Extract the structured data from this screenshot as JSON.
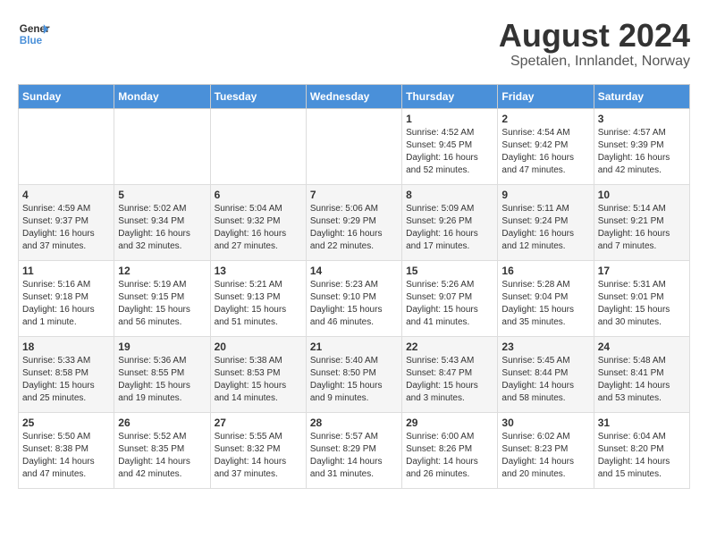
{
  "header": {
    "logo_general": "General",
    "logo_blue": "Blue",
    "title": "August 2024",
    "subtitle": "Spetalen, Innlandet, Norway"
  },
  "weekdays": [
    "Sunday",
    "Monday",
    "Tuesday",
    "Wednesday",
    "Thursday",
    "Friday",
    "Saturday"
  ],
  "weeks": [
    [
      {
        "day": "",
        "info": ""
      },
      {
        "day": "",
        "info": ""
      },
      {
        "day": "",
        "info": ""
      },
      {
        "day": "",
        "info": ""
      },
      {
        "day": "1",
        "info": "Sunrise: 4:52 AM\nSunset: 9:45 PM\nDaylight: 16 hours\nand 52 minutes."
      },
      {
        "day": "2",
        "info": "Sunrise: 4:54 AM\nSunset: 9:42 PM\nDaylight: 16 hours\nand 47 minutes."
      },
      {
        "day": "3",
        "info": "Sunrise: 4:57 AM\nSunset: 9:39 PM\nDaylight: 16 hours\nand 42 minutes."
      }
    ],
    [
      {
        "day": "4",
        "info": "Sunrise: 4:59 AM\nSunset: 9:37 PM\nDaylight: 16 hours\nand 37 minutes."
      },
      {
        "day": "5",
        "info": "Sunrise: 5:02 AM\nSunset: 9:34 PM\nDaylight: 16 hours\nand 32 minutes."
      },
      {
        "day": "6",
        "info": "Sunrise: 5:04 AM\nSunset: 9:32 PM\nDaylight: 16 hours\nand 27 minutes."
      },
      {
        "day": "7",
        "info": "Sunrise: 5:06 AM\nSunset: 9:29 PM\nDaylight: 16 hours\nand 22 minutes."
      },
      {
        "day": "8",
        "info": "Sunrise: 5:09 AM\nSunset: 9:26 PM\nDaylight: 16 hours\nand 17 minutes."
      },
      {
        "day": "9",
        "info": "Sunrise: 5:11 AM\nSunset: 9:24 PM\nDaylight: 16 hours\nand 12 minutes."
      },
      {
        "day": "10",
        "info": "Sunrise: 5:14 AM\nSunset: 9:21 PM\nDaylight: 16 hours\nand 7 minutes."
      }
    ],
    [
      {
        "day": "11",
        "info": "Sunrise: 5:16 AM\nSunset: 9:18 PM\nDaylight: 16 hours\nand 1 minute."
      },
      {
        "day": "12",
        "info": "Sunrise: 5:19 AM\nSunset: 9:15 PM\nDaylight: 15 hours\nand 56 minutes."
      },
      {
        "day": "13",
        "info": "Sunrise: 5:21 AM\nSunset: 9:13 PM\nDaylight: 15 hours\nand 51 minutes."
      },
      {
        "day": "14",
        "info": "Sunrise: 5:23 AM\nSunset: 9:10 PM\nDaylight: 15 hours\nand 46 minutes."
      },
      {
        "day": "15",
        "info": "Sunrise: 5:26 AM\nSunset: 9:07 PM\nDaylight: 15 hours\nand 41 minutes."
      },
      {
        "day": "16",
        "info": "Sunrise: 5:28 AM\nSunset: 9:04 PM\nDaylight: 15 hours\nand 35 minutes."
      },
      {
        "day": "17",
        "info": "Sunrise: 5:31 AM\nSunset: 9:01 PM\nDaylight: 15 hours\nand 30 minutes."
      }
    ],
    [
      {
        "day": "18",
        "info": "Sunrise: 5:33 AM\nSunset: 8:58 PM\nDaylight: 15 hours\nand 25 minutes."
      },
      {
        "day": "19",
        "info": "Sunrise: 5:36 AM\nSunset: 8:55 PM\nDaylight: 15 hours\nand 19 minutes."
      },
      {
        "day": "20",
        "info": "Sunrise: 5:38 AM\nSunset: 8:53 PM\nDaylight: 15 hours\nand 14 minutes."
      },
      {
        "day": "21",
        "info": "Sunrise: 5:40 AM\nSunset: 8:50 PM\nDaylight: 15 hours\nand 9 minutes."
      },
      {
        "day": "22",
        "info": "Sunrise: 5:43 AM\nSunset: 8:47 PM\nDaylight: 15 hours\nand 3 minutes."
      },
      {
        "day": "23",
        "info": "Sunrise: 5:45 AM\nSunset: 8:44 PM\nDaylight: 14 hours\nand 58 minutes."
      },
      {
        "day": "24",
        "info": "Sunrise: 5:48 AM\nSunset: 8:41 PM\nDaylight: 14 hours\nand 53 minutes."
      }
    ],
    [
      {
        "day": "25",
        "info": "Sunrise: 5:50 AM\nSunset: 8:38 PM\nDaylight: 14 hours\nand 47 minutes."
      },
      {
        "day": "26",
        "info": "Sunrise: 5:52 AM\nSunset: 8:35 PM\nDaylight: 14 hours\nand 42 minutes."
      },
      {
        "day": "27",
        "info": "Sunrise: 5:55 AM\nSunset: 8:32 PM\nDaylight: 14 hours\nand 37 minutes."
      },
      {
        "day": "28",
        "info": "Sunrise: 5:57 AM\nSunset: 8:29 PM\nDaylight: 14 hours\nand 31 minutes."
      },
      {
        "day": "29",
        "info": "Sunrise: 6:00 AM\nSunset: 8:26 PM\nDaylight: 14 hours\nand 26 minutes."
      },
      {
        "day": "30",
        "info": "Sunrise: 6:02 AM\nSunset: 8:23 PM\nDaylight: 14 hours\nand 20 minutes."
      },
      {
        "day": "31",
        "info": "Sunrise: 6:04 AM\nSunset: 8:20 PM\nDaylight: 14 hours\nand 15 minutes."
      }
    ]
  ]
}
